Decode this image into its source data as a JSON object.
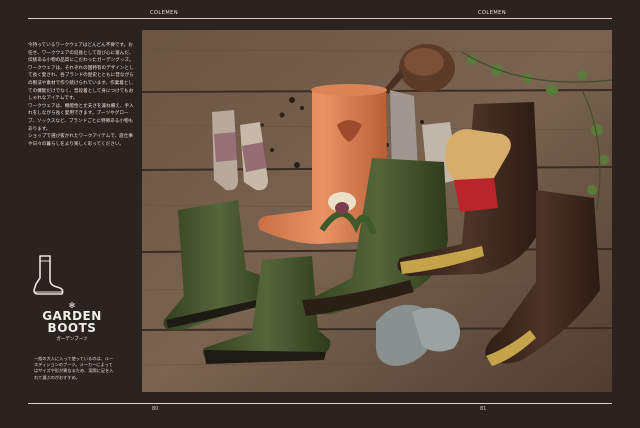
{
  "header": {
    "left_label": "COLEMEN",
    "right_label": "COLEMEN"
  },
  "footer": {
    "left_page": "80",
    "right_page": "81"
  },
  "body_paragraphs": [
    "今持っているワークウェアはどんどん不要です。お任せ、ワークウェアの延長として遊び心に富んだ、伝統ある小物の品質にこだわったガーデングッズ。",
    "ワークウェアは、それぞれの国特有のデザインとして長く愛され、各ブランドの歴史とともに昔ながらの製法や素材で作り続けられています。作業着としての機能だけでなく、普段着として身につけてもおしゃれなアイテムです。",
    "ワークウェアは、機能性と丈夫さを兼ね備え、手入れをしながら長く愛用できます。ブーツやグローブ、ソックスなど、ブランドごとに特徴ある小物もあります。",
    "ショップで選び抜かれたワークアイテムで、庭仕事や日々の暮らしをより楽しく彩ってください。"
  ],
  "logo": {
    "star": "✻",
    "line1": "GARDEN",
    "line2": "BOOTS",
    "kana": "ガーデンブーツ"
  },
  "caption": "一般の大人に入って使っているのは、ルーエディションのブーツ。メーカーによってはサイズや形が異なるため、実際に足を入れて選ぶのがおすすめ。",
  "icons": {
    "boot": "boot-icon"
  },
  "colors": {
    "background": "#2a2320",
    "text": "#e6e0d6",
    "rule": "#d8d2c8"
  }
}
